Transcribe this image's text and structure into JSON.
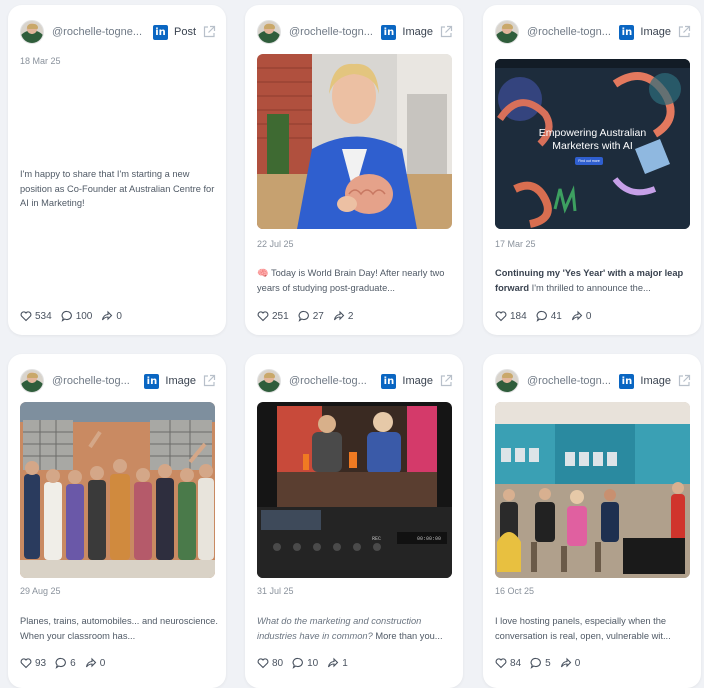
{
  "cards": [
    {
      "handle": "@rochelle-togne...",
      "type": "Post",
      "date": "18 Mar 25",
      "text": "I'm happy to share that I'm starting a new position as Co-Founder at Australian Centre for AI in Marketing!",
      "likes": "534",
      "comments": "100",
      "shares": "0"
    },
    {
      "handle": "@rochelle-togn...",
      "type": "Image",
      "date": "22 Jul 25",
      "text": "🧠 Today is World Brain Day! After nearly two years of studying post-graduate...",
      "likes": "251",
      "comments": "27",
      "shares": "2"
    },
    {
      "handle": "@rochelle-togn...",
      "type": "Image",
      "date": "17 Mar 25",
      "text_bold": "Continuing my 'Yes Year' with a major leap forward",
      "text": " I'm thrilled to announce the...",
      "image_headline": "Empowering Australian Marketers with AI",
      "image_button": "Find out more",
      "likes": "184",
      "comments": "41",
      "shares": "0"
    },
    {
      "handle": "@rochelle-tog...",
      "type": "Image",
      "date": "29 Aug 25",
      "text": "Planes, trains, automobiles... and neuroscience. When your classroom has...",
      "likes": "93",
      "comments": "6",
      "shares": "0"
    },
    {
      "handle": "@rochelle-tog...",
      "type": "Image",
      "date": "31 Jul 25",
      "text_italic": "What do the marketing and construction industries have in common?",
      "text": " More than you...",
      "likes": "80",
      "comments": "10",
      "shares": "1"
    },
    {
      "handle": "@rochelle-togn...",
      "type": "Image",
      "date": "16 Oct 25",
      "text": "I love hosting panels, especially when the conversation is real, open, vulnerable wit...",
      "likes": "84",
      "comments": "5",
      "shares": "0"
    }
  ],
  "colors": {
    "linkedin": "#0a66c2",
    "background": "#f0f2f6",
    "card": "#ffffff"
  },
  "icons": [
    "avatar",
    "linkedin-icon",
    "external-link-icon",
    "heart-icon",
    "comment-icon",
    "share-icon"
  ]
}
